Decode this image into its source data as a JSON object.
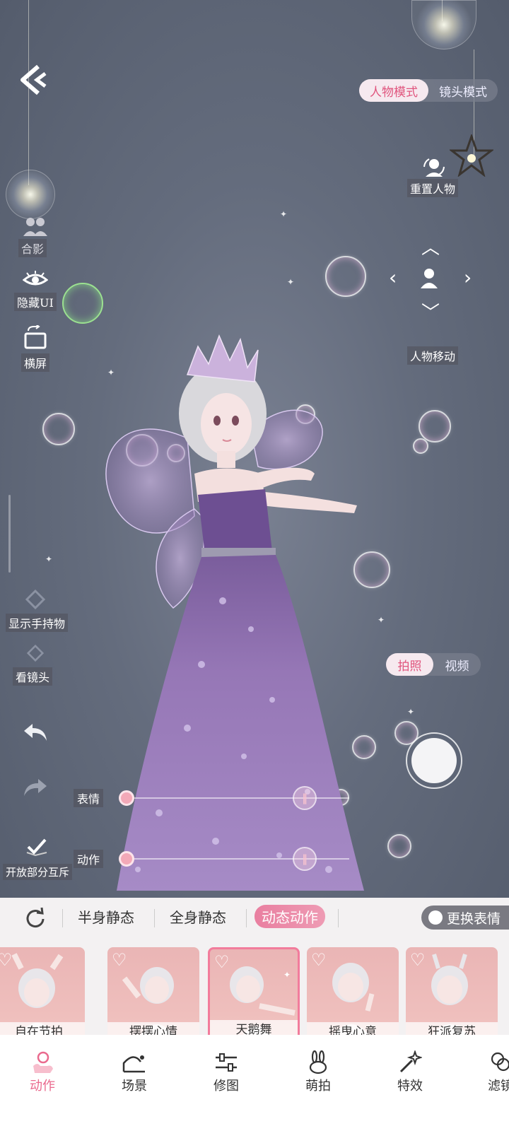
{
  "top": {
    "mode_toggle": {
      "options": [
        "人物模式",
        "镜头模式"
      ],
      "active": 0
    },
    "reset_character": "重置人物",
    "move_character": "人物移动"
  },
  "left_tools": {
    "group_photo": "合影",
    "hide_ui": "隐藏UI",
    "landscape": "横屏",
    "show_held_item": "显示手持物",
    "look_camera": "看镜头",
    "open_partial": "开放部分互斥"
  },
  "capture": {
    "options": [
      "拍照",
      "视频"
    ],
    "active": 0
  },
  "sliders": {
    "expression": "表情",
    "action": "动作"
  },
  "categories": {
    "items": [
      "半身静态",
      "全身静态",
      "动态动作"
    ],
    "active": 2,
    "change_expression": "更换表情"
  },
  "cards": [
    {
      "label": "自在节拍"
    },
    {
      "label": "摆摆心情"
    },
    {
      "label": "天鹅舞",
      "selected": true
    },
    {
      "label": "摇曳心意"
    },
    {
      "label": "狂派复苏"
    }
  ],
  "tabs": [
    {
      "label": "动作",
      "icon": "pose-icon",
      "active": true
    },
    {
      "label": "场景",
      "icon": "scene-icon"
    },
    {
      "label": "修图",
      "icon": "adjust-icon"
    },
    {
      "label": "萌拍",
      "icon": "bunny-icon"
    },
    {
      "label": "特效",
      "icon": "magic-wand-icon"
    },
    {
      "label": "滤镜",
      "icon": "filter-icon"
    }
  ],
  "colors": {
    "accent": "#ea6a8e",
    "scene_bg": "#646c7d",
    "card_bg": "#eab5b5"
  }
}
